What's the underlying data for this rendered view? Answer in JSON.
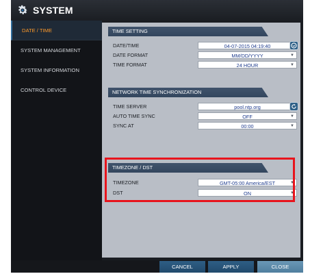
{
  "window": {
    "title": "SYSTEM"
  },
  "sidebar": {
    "items": [
      {
        "label": "DATE / TIME"
      },
      {
        "label": "SYSTEM MANAGEMENT"
      },
      {
        "label": "SYSTEM INFORMATION"
      },
      {
        "label": "CONTROL DEVICE"
      }
    ]
  },
  "time_setting": {
    "header": "TIME SETTING",
    "date_time": {
      "label": "DATE/TIME",
      "value": "04-07-2015 04:19:40"
    },
    "date_format": {
      "label": "DATE FORMAT",
      "value": "MM/DD/YYYY"
    },
    "time_format": {
      "label": "TIME FORMAT",
      "value": "24 HOUR"
    }
  },
  "ntp": {
    "header": "NETWORK TIME SYNCHRONIZATION",
    "time_server": {
      "label": "TIME SERVER",
      "value": "pool.ntp.org"
    },
    "auto_sync": {
      "label": "AUTO TIME SYNC",
      "value": "OFF"
    },
    "sync_at": {
      "label": "SYNC AT",
      "value": "00:00"
    }
  },
  "timezone": {
    "header": "TIMEZONE / DST",
    "timezone": {
      "label": "TIMEZONE",
      "value": "GMT-05:00 America/EST"
    },
    "dst": {
      "label": "DST",
      "value": "ON"
    }
  },
  "footer": {
    "cancel": "CANCEL",
    "apply": "APPLY",
    "close": "CLOSE"
  },
  "icons": {
    "title": "gear-icon",
    "calendar": "calendar-icon",
    "refresh": "refresh-icon",
    "dropdown": "chevron-down-icon"
  },
  "colors": {
    "highlight": "#e8141c",
    "active_menu": "#ff9a2a",
    "section_header": "#3a4d66",
    "panel": "#b9bec6"
  }
}
